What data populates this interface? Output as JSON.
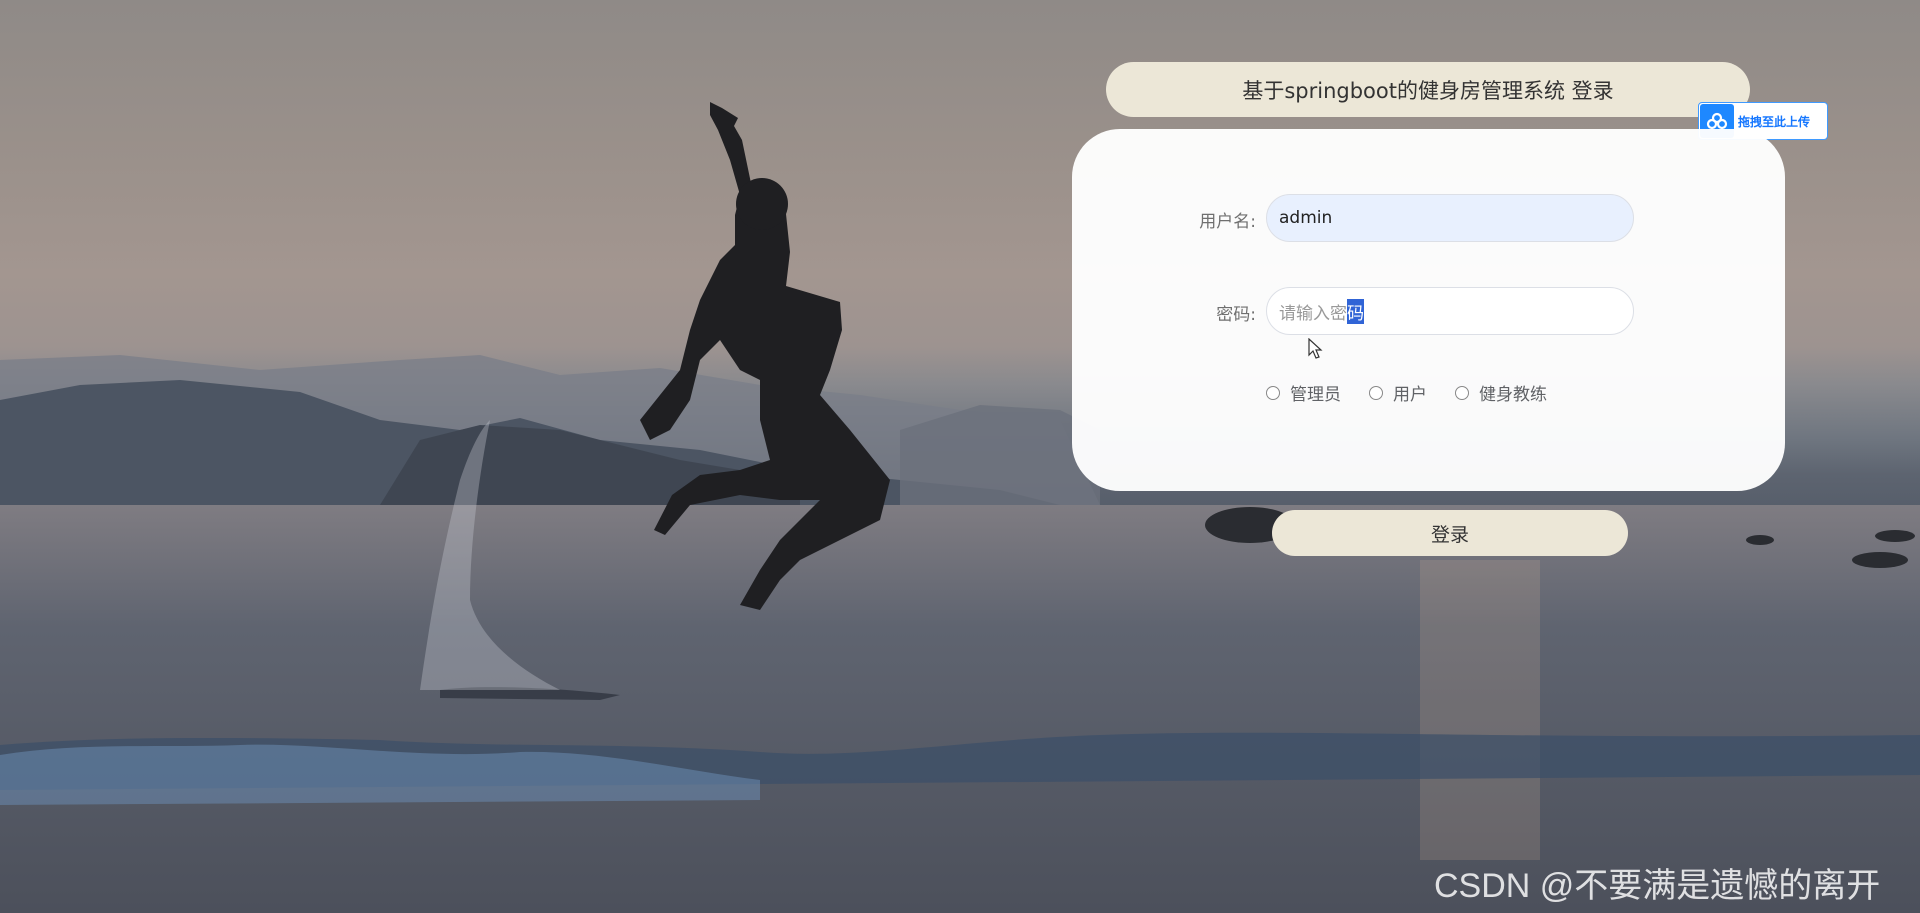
{
  "page": {
    "title": "基于springboot的健身房管理系统 登录"
  },
  "upload_badge": {
    "label": "拖拽至此上传",
    "icon": "cloud-upload-icon"
  },
  "form": {
    "username_label": "用户名:",
    "username_value": "admin",
    "password_label": "密码:",
    "password_placeholder_before": "请输入密",
    "password_placeholder_selected": "码",
    "roles": [
      {
        "label": "管理员"
      },
      {
        "label": "用户"
      },
      {
        "label": "健身教练"
      }
    ],
    "login_button": "登录"
  },
  "watermark": {
    "text": "CSDN @不要满是遗憾的离开"
  },
  "colors": {
    "title_bg": "#ece7d7",
    "panel_bg": "#ffffff",
    "button_bg": "#ece7d7",
    "autofill_bg": "#e8f0fe",
    "selection": "#3064d6",
    "badge_accent": "#1e88ff"
  }
}
